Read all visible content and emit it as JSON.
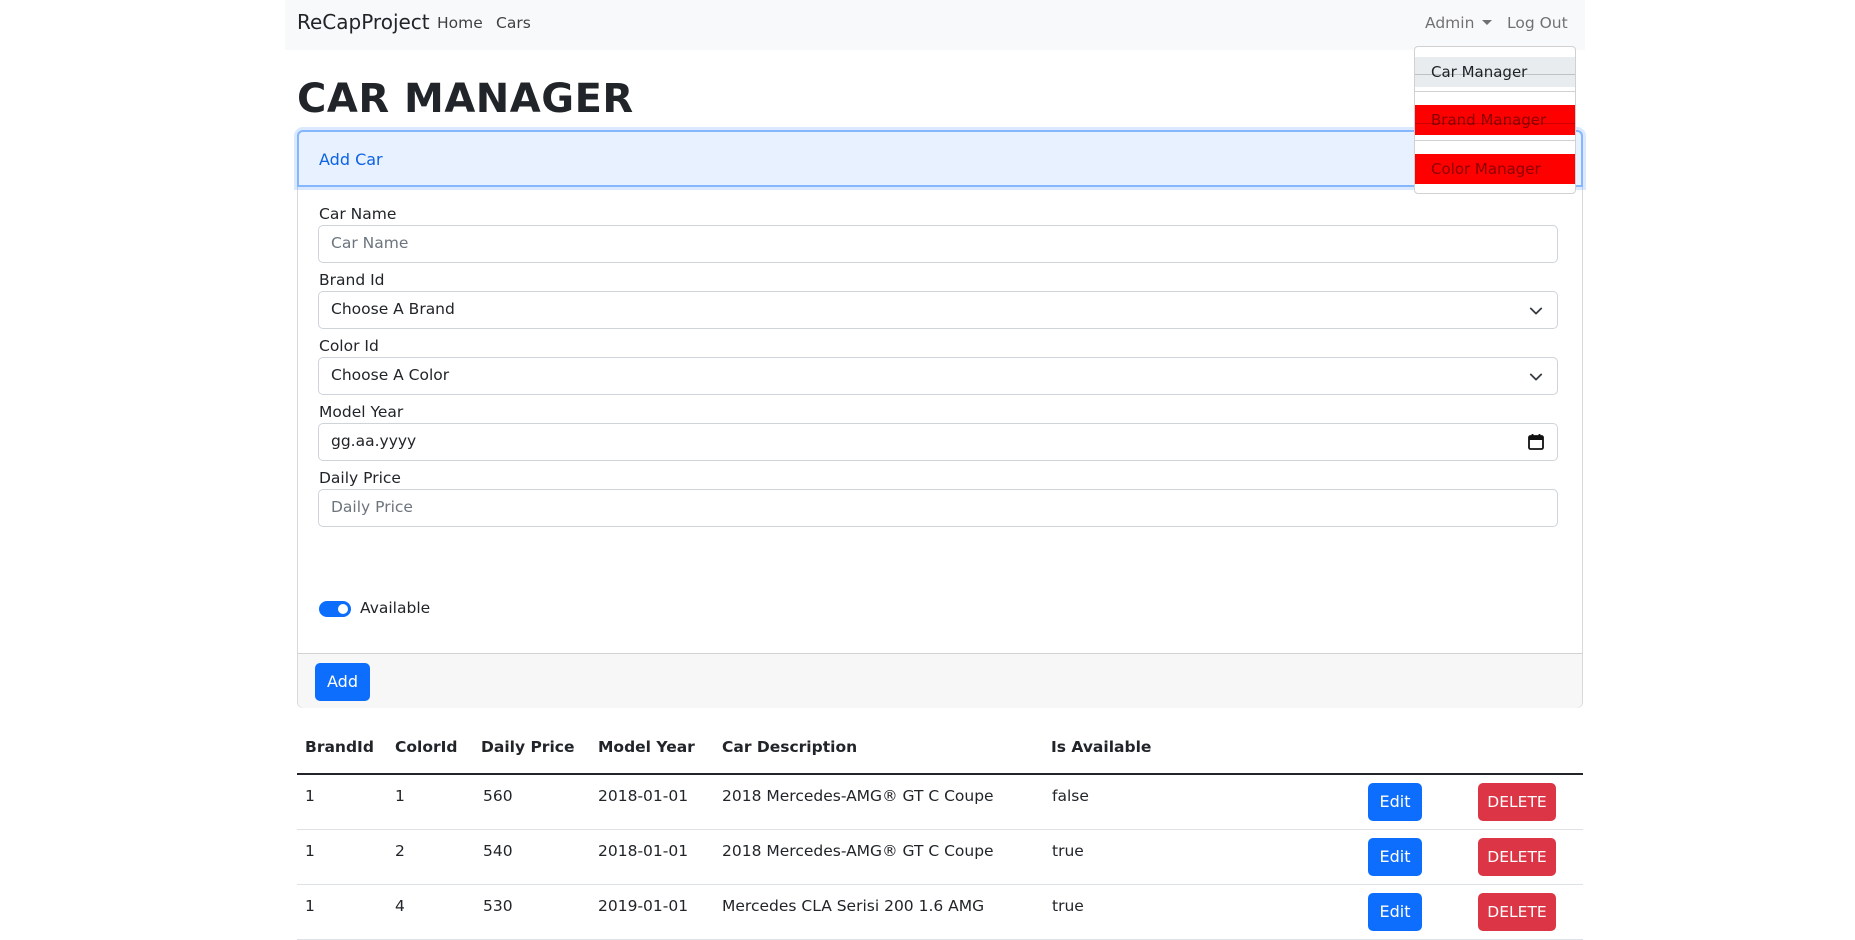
{
  "navbar": {
    "brand": "ReCapProject",
    "home": "Home",
    "cars": "Cars",
    "admin": "Admin",
    "logout": "Log Out"
  },
  "dropdown": {
    "items": [
      "Car Manager",
      "Brand Manager",
      "Color Manager"
    ],
    "highlight_color": "#ff0000"
  },
  "page": {
    "title": "CAR MANAGER"
  },
  "form": {
    "header": "Add Car",
    "car_name": {
      "label": "Car Name",
      "placeholder": "Car Name"
    },
    "brand_id": {
      "label": "Brand Id",
      "value": "Choose A Brand"
    },
    "color_id": {
      "label": "Color Id",
      "value": "Choose A Color"
    },
    "model_year": {
      "label": "Model Year",
      "value": "gg.aa.yyyy"
    },
    "daily_price": {
      "label": "Daily Price",
      "placeholder": "Daily Price"
    },
    "available": {
      "label": "Available",
      "checked": true
    },
    "add_button": "Add"
  },
  "table": {
    "headers": [
      "BrandId",
      "ColorId",
      "Daily Price",
      "Model Year",
      "Car Description",
      "Is Available"
    ],
    "rows": [
      {
        "brandId": "1",
        "colorId": "1",
        "price": "560",
        "year": "2018-01-01",
        "desc": "2018 Mercedes-AMG® GT C Coupe",
        "available": "false"
      },
      {
        "brandId": "1",
        "colorId": "2",
        "price": "540",
        "year": "2018-01-01",
        "desc": "2018 Mercedes-AMG® GT C Coupe",
        "available": "true"
      },
      {
        "brandId": "1",
        "colorId": "4",
        "price": "530",
        "year": "2019-01-01",
        "desc": "Mercedes CLA Serisi 200 1.6 AMG",
        "available": "true"
      }
    ],
    "edit_label": "Edit",
    "delete_label": "DELETE"
  },
  "colors": {
    "primary": "#0d6efd",
    "danger": "#dc3545"
  }
}
